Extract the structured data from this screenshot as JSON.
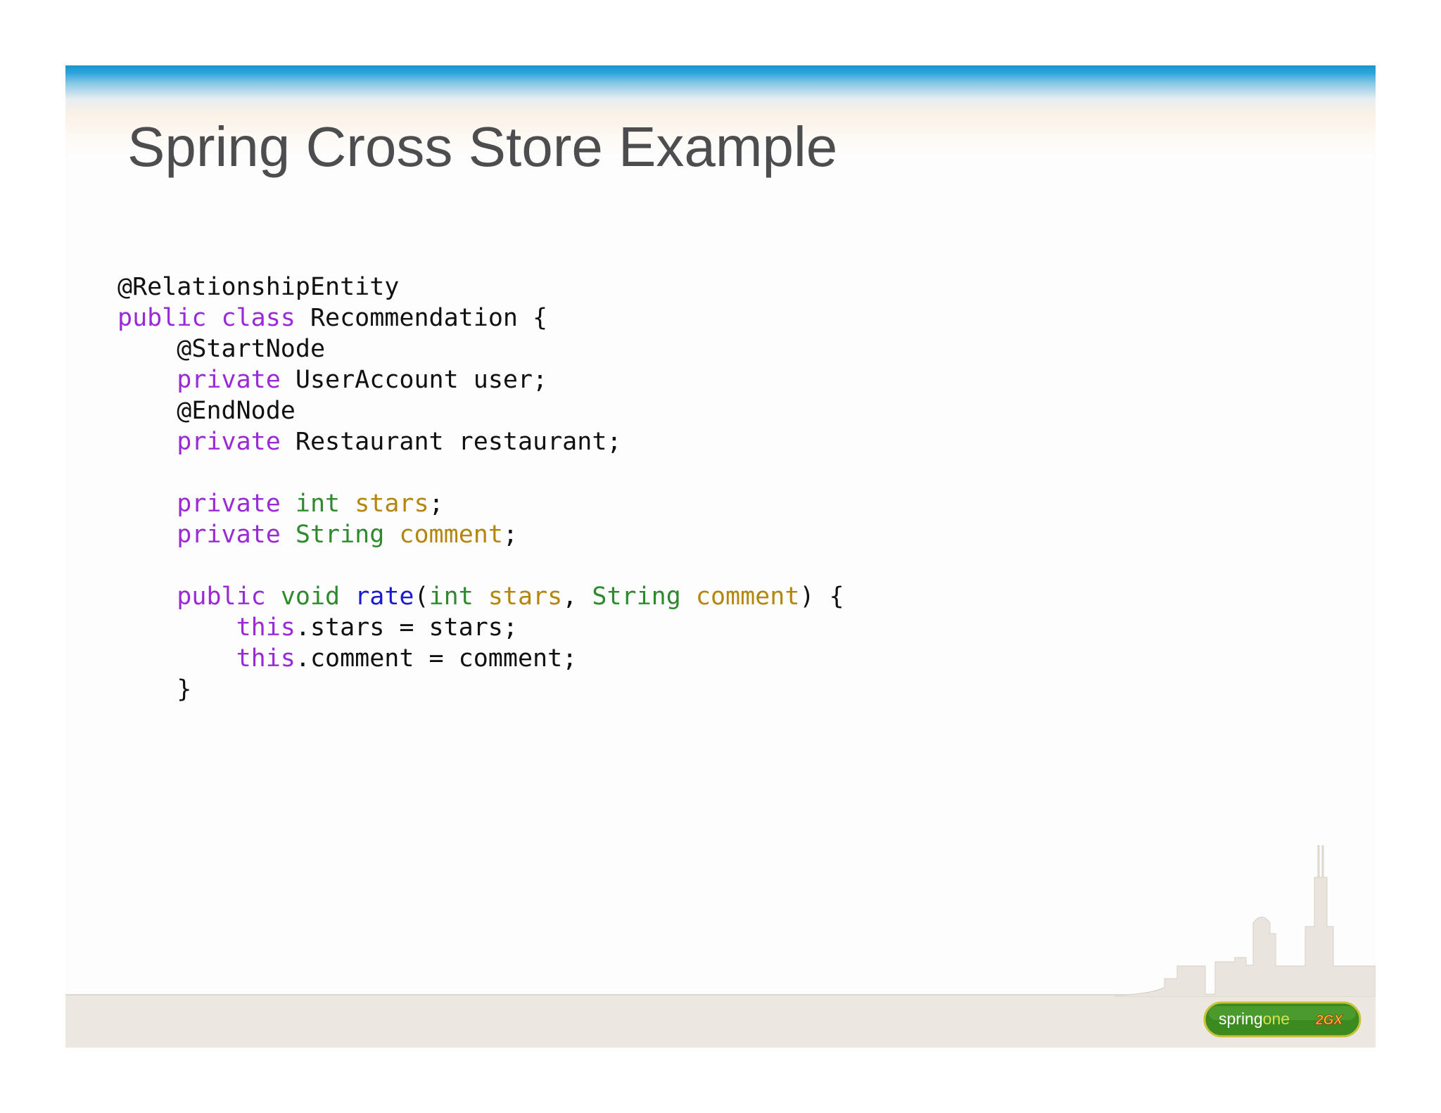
{
  "slide": {
    "title": "Spring Cross Store Example"
  },
  "code": {
    "l1": {
      "annotation": "@RelationshipEntity"
    },
    "l2": {
      "kw1": "public",
      "kw2": "class",
      "text": "Recommendation {"
    },
    "l3": {
      "indent": "    ",
      "annotation": "@StartNode"
    },
    "l4": {
      "indent": "    ",
      "kw": "private",
      "text": "UserAccount user;"
    },
    "l5": {
      "indent": "    ",
      "annotation": "@EndNode"
    },
    "l6": {
      "indent": "    ",
      "kw": "private",
      "text": "Restaurant restaurant;"
    },
    "l8": {
      "indent": "    ",
      "kw": "private",
      "type": "int",
      "field": "stars",
      "end": ";"
    },
    "l9": {
      "indent": "    ",
      "kw": "private",
      "type": "String",
      "field": "comment",
      "end": ";"
    },
    "l11": {
      "indent": "    ",
      "kw": "public",
      "type": "void",
      "method": "rate",
      "paren": "(",
      "ptype1": "int",
      "pname1": "stars",
      "comma": ",",
      "ptype2": "String",
      "pname2": "comment",
      "end": ") {"
    },
    "l12": {
      "indent": "        ",
      "kw": "this",
      "text": ".stars = stars;"
    },
    "l13": {
      "indent": "        ",
      "kw": "this",
      "text": ".comment = comment;"
    },
    "l14": {
      "indent": "    ",
      "text": "}"
    }
  },
  "footer": {
    "logo": {
      "word1": "spring",
      "word2": "one",
      "badge": "2GX"
    }
  },
  "colors": {
    "keyword": "#9a2ad6",
    "type": "#2d8a2d",
    "field": "#b5860c",
    "method": "#1a1ad0",
    "title": "#4d4d4f",
    "header_blue": "#1494d0",
    "footer_bg": "#ece7e1",
    "logo_green": "#3b8a1f"
  }
}
